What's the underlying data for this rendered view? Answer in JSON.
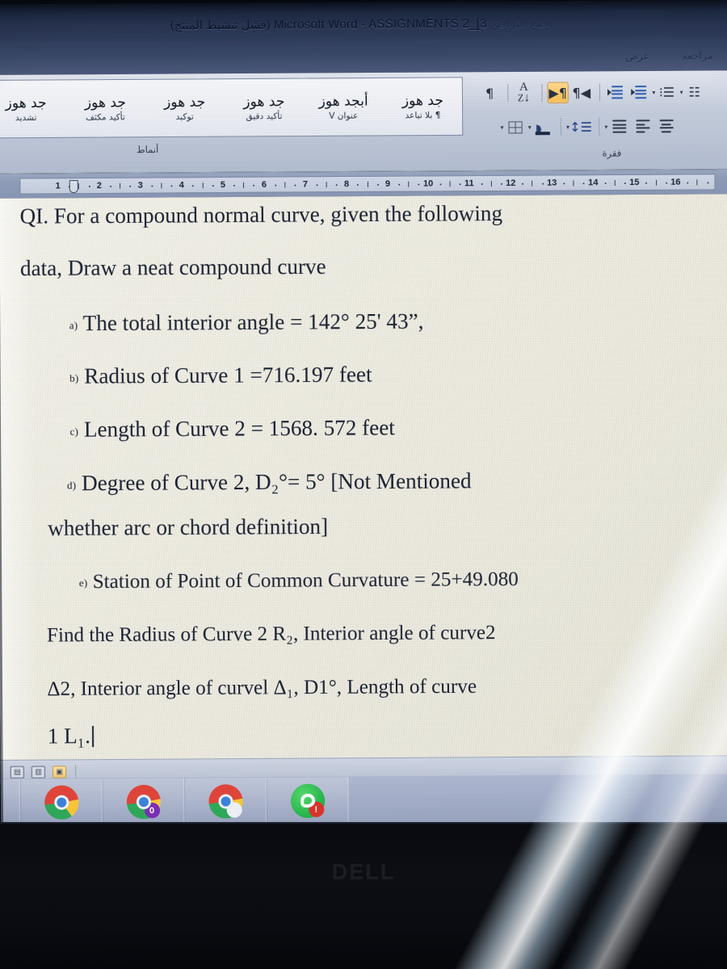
{
  "window": {
    "title_arabic": "(فشل تنشيط المنتج)",
    "title_app": "Microsoft Word",
    "title_sep": "-",
    "title_document": "ASSIGNMENTS 2_[3",
    "title_tail": "وضع التوافق"
  },
  "tabs": [
    {
      "id": "view",
      "label": "عرض"
    },
    {
      "id": "review",
      "label": "مراجعة"
    }
  ],
  "ribbon": {
    "styles_group": {
      "label": "أنماط",
      "items": [
        {
          "sample": "جد هوز",
          "name": "¶ بلا تباعد"
        },
        {
          "sample": "أبجد هوز",
          "name": "عنوان V"
        },
        {
          "sample": "جد هوز",
          "name": "تأكيد دقيق"
        },
        {
          "sample": "جد هوز",
          "name": "توكيد"
        },
        {
          "sample": "جد هوز",
          "name": "تأكيد مكثف"
        },
        {
          "sample": "جد هوز",
          "name": "تشديد"
        }
      ]
    },
    "paragraph_group": {
      "label": "فقرة",
      "buttons": [
        {
          "id": "show-formatting-marks",
          "icon": "pilcrow-icon",
          "glyph": "¶",
          "active": false
        },
        {
          "id": "sort",
          "icon": "sort-az-icon",
          "glyph": "A\\nZ↓",
          "active": false
        },
        {
          "id": "rtl-direction",
          "icon": "rtl-text-direction-icon",
          "glyph": "▶¶",
          "active": true
        },
        {
          "id": "ltr-direction",
          "icon": "ltr-text-direction-icon",
          "glyph": "¶◀",
          "active": false
        },
        {
          "id": "decrease-indent",
          "icon": "decrease-indent-icon",
          "active": false
        },
        {
          "id": "increase-indent",
          "icon": "increase-indent-icon",
          "active": false
        },
        {
          "id": "multilevel-list",
          "icon": "multilevel-list-icon",
          "active": false
        },
        {
          "id": "numbered-list",
          "icon": "numbered-list-icon",
          "active": false
        },
        {
          "id": "borders",
          "icon": "borders-icon",
          "active": false
        },
        {
          "id": "shading",
          "icon": "shading-icon",
          "active": false
        },
        {
          "id": "line-spacing",
          "icon": "line-spacing-icon",
          "active": false
        },
        {
          "id": "align-justify",
          "icon": "align-justify-icon",
          "active": false
        },
        {
          "id": "align-right",
          "icon": "align-right-icon",
          "active": false
        },
        {
          "id": "align-center",
          "icon": "align-center-icon",
          "active": false
        }
      ]
    }
  },
  "ruler": {
    "numbers": [
      1,
      2,
      3,
      4,
      5,
      6,
      7,
      8,
      9,
      10,
      11,
      12,
      13,
      14,
      15,
      16
    ]
  },
  "document": {
    "paragraphs": [
      {
        "id": "q1-line1",
        "text": "QI. For a compound normal curve, given the following"
      },
      {
        "id": "q1-line2",
        "text": "data, Draw a neat compound curve"
      },
      {
        "id": "item-a",
        "label": "a)",
        "text": "The total interior angle = 142° 25' 43”,"
      },
      {
        "id": "item-b",
        "label": "b)",
        "text": "Radius of Curve 1 =716.197 feet"
      },
      {
        "id": "item-c",
        "label": "c)",
        "text": "Length of Curve 2 = 1568. 572 feet"
      },
      {
        "id": "item-d",
        "label": "d)",
        "text": "Degree  of  Curve  2,  D₂°=  5°  [Not  Mentioned"
      },
      {
        "id": "item-d-cont",
        "label": "",
        "text": "whether arc or chord definition]"
      },
      {
        "id": "item-e",
        "label": "e)",
        "text": "Station of Point of Common Curvature = 25+49.080"
      },
      {
        "id": "find-line1",
        "label": "",
        "text": "Find the Radius of Curve 2 R₂, Interior angle of curve2"
      },
      {
        "id": "find-line2",
        "label": "",
        "text": "Δ2, Interior angle of curvel Δ₁, D1°, Length of curve"
      },
      {
        "id": "find-line3",
        "label": "",
        "text": "1 L₁."
      }
    ],
    "values": {
      "total_interior_angle": "142° 25' 43\"",
      "radius_curve_1": "716.197 feet",
      "length_curve_2": "1568. 572 feet",
      "degree_curve_2": "5°",
      "station_pcc": "25+49.080"
    }
  },
  "status_bar": {
    "buttons": [
      {
        "id": "print-layout-view",
        "icon": "print-layout-icon",
        "glyph": "▤",
        "selected": false
      },
      {
        "id": "full-screen-reading-view",
        "icon": "reading-view-icon",
        "glyph": "▥",
        "selected": false
      },
      {
        "id": "web-layout-view",
        "icon": "web-layout-icon",
        "glyph": "▣",
        "selected": true
      }
    ]
  },
  "taskbar": {
    "items": [
      {
        "id": "app-1",
        "icon": "window-icon",
        "badge": ""
      },
      {
        "id": "chrome-1",
        "icon": "chrome-icon",
        "badge": ""
      },
      {
        "id": "chrome-2",
        "icon": "chrome-icon",
        "badge": "0",
        "badge_color": "purple"
      },
      {
        "id": "chrome-3",
        "icon": "chrome-icon",
        "badge": "",
        "badge_color": "white"
      },
      {
        "id": "whatsapp",
        "icon": "whatsapp-icon",
        "badge": "!",
        "badge_color": "red"
      }
    ]
  },
  "bezel": {
    "brand": "DELL"
  },
  "colors": {
    "titlebar": "#27334f",
    "ribbon": "#c6cedd",
    "page": "#ece9de",
    "accent_highlight": "#f6bd55",
    "taskbar": "#a3adc7",
    "bezel": "#0a0c11"
  }
}
